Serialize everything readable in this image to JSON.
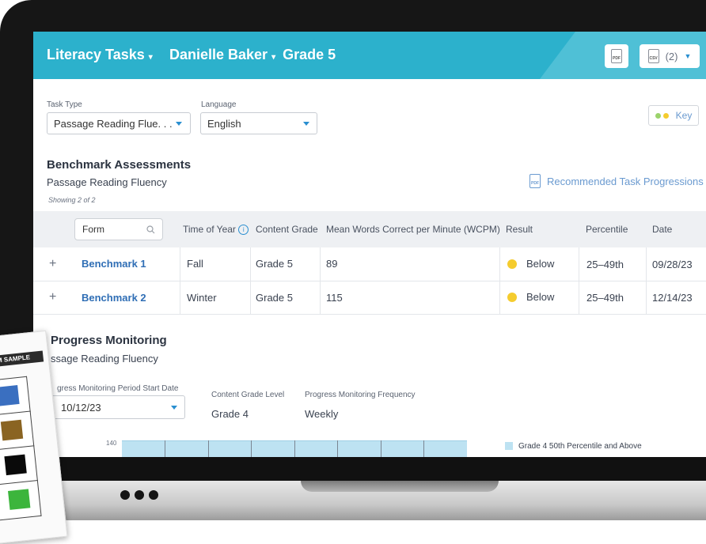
{
  "header": {
    "app_title": "Literacy Tasks",
    "student": "Danielle Baker",
    "grade": "Grade 5",
    "pdf_icon_text": "PDF",
    "csv_icon_text": "CSV",
    "csv_count": "(2)"
  },
  "filters": {
    "task_type_label": "Task Type",
    "task_type_value": "Passage Reading Flue. . .",
    "language_label": "Language",
    "language_value": "English",
    "key_label": "Key"
  },
  "benchmark": {
    "title": "Benchmark Assessments",
    "subtitle": "Passage Reading Fluency",
    "showing": "Showing 2 of 2",
    "recommended_label": "Recommended Task Progressions",
    "form_placeholder": "Form",
    "columns": [
      "Time of Year",
      "Content Grade",
      "Mean Words Correct per Minute (WCPM)",
      "Result",
      "Percentile",
      "Date"
    ],
    "rows": [
      {
        "expand": "+",
        "form": "Benchmark 1",
        "time": "Fall",
        "grade": "Grade 5",
        "wcpm": "89",
        "result": "Below",
        "percentile": "25–49th",
        "date": "09/28/23"
      },
      {
        "expand": "+",
        "form": "Benchmark 2",
        "time": "Winter",
        "grade": "Grade 5",
        "wcpm": "115",
        "result": "Below",
        "percentile": "25–49th",
        "date": "12/14/23"
      }
    ]
  },
  "progress": {
    "title": "Progress Monitoring",
    "subtitle": "ssage Reading Fluency",
    "period_label": "gress Monitoring Period Start Date",
    "period_value": "10/12/23",
    "grade_level_label": "Content Grade Level",
    "grade_level_value": "Grade 4",
    "frequency_label": "Progress Monitoring Frequency",
    "frequency_value": "Weekly",
    "chart_tick": "140",
    "legend": "Grade 4 50th Percentile and Above"
  },
  "paper_sheet": {
    "label": "–FORM SAMPLE",
    "swatches": [
      "#3a6fc0",
      "#8a6422",
      "#0a0a0a",
      "#3cb53c"
    ]
  },
  "colors": {
    "header": "#2cb1cc",
    "link": "#2f6eb5",
    "result_below": "#f5cc2e",
    "key_dot_green": "#9bd36b",
    "key_dot_yellow": "#f5cc2e"
  }
}
